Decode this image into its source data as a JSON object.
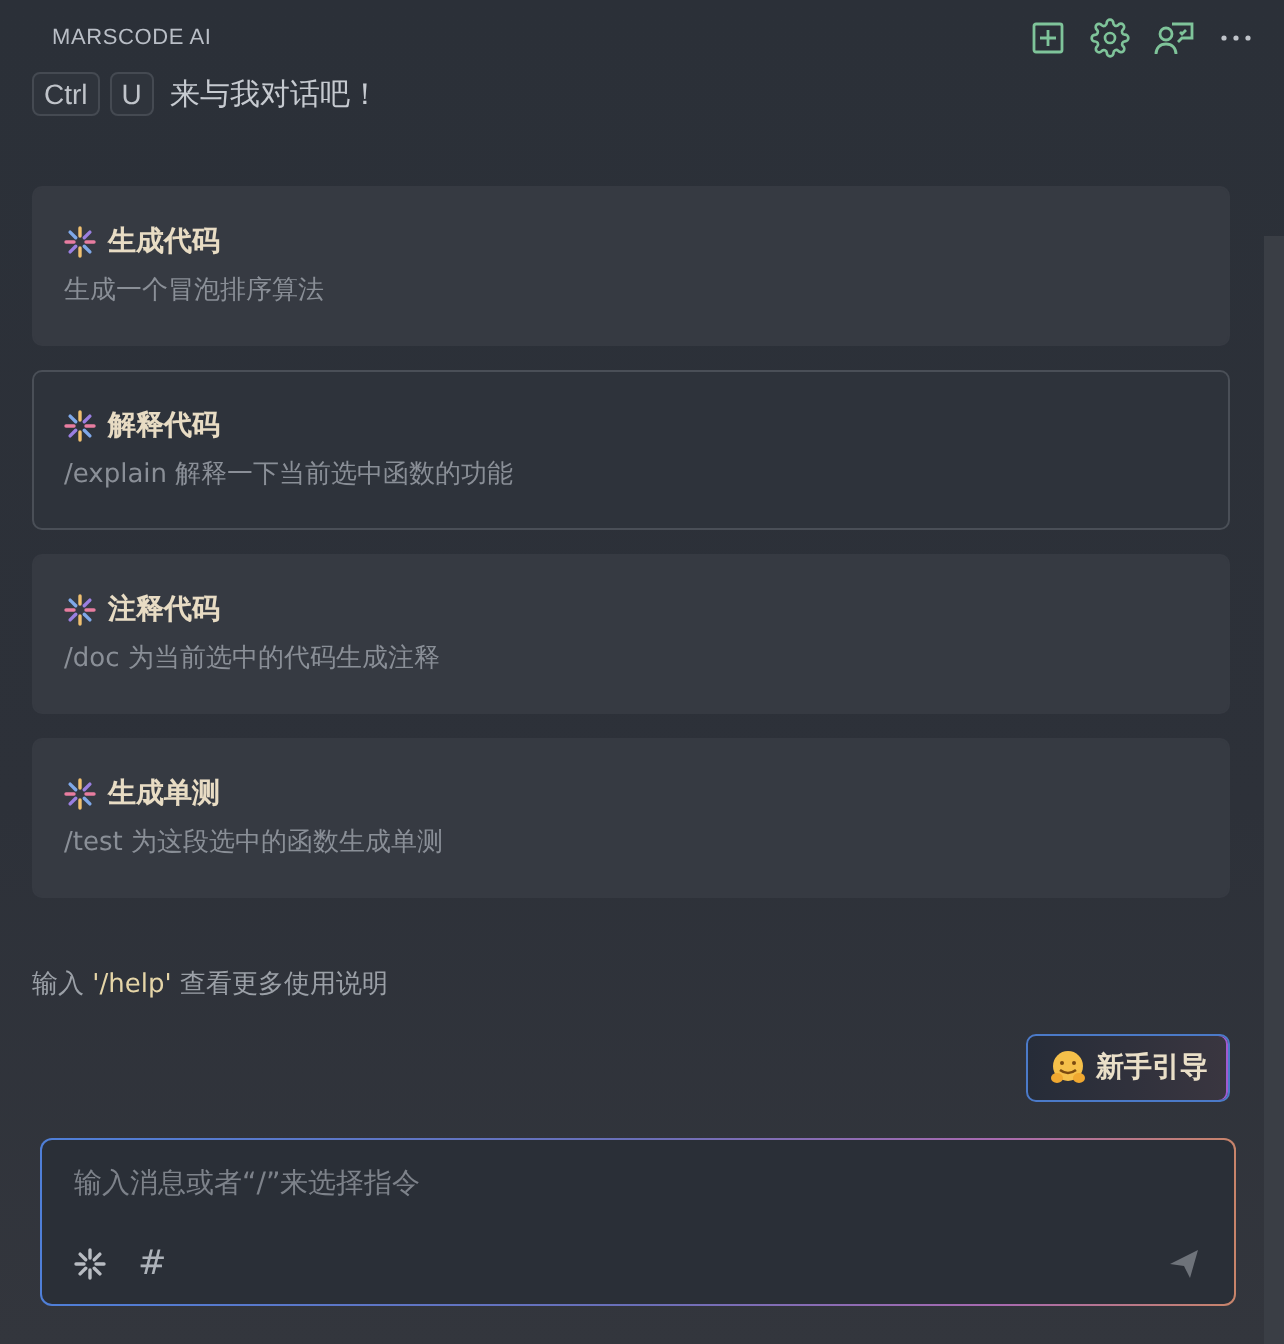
{
  "panel": {
    "title": "MARSCODE AI"
  },
  "shortcut": {
    "keys": [
      "Ctrl",
      "U"
    ],
    "text": "来与我对话吧！"
  },
  "cards": [
    {
      "title": "生成代码",
      "description": "生成一个冒泡排序算法",
      "selected": false
    },
    {
      "title": "解释代码",
      "description": "/explain 解释一下当前选中函数的功能",
      "selected": true
    },
    {
      "title": "注释代码",
      "description": "/doc 为当前选中的代码生成注释",
      "selected": false
    },
    {
      "title": "生成单测",
      "description": "/test 为这段选中的函数生成单测",
      "selected": false
    }
  ],
  "help": {
    "prefix": "输入 ",
    "command": "'/help'",
    "suffix": " 查看更多使用说明"
  },
  "guide_button": {
    "label": "新手引导"
  },
  "input": {
    "placeholder": "输入消息或者“/”来选择指令",
    "hash": "#"
  }
}
